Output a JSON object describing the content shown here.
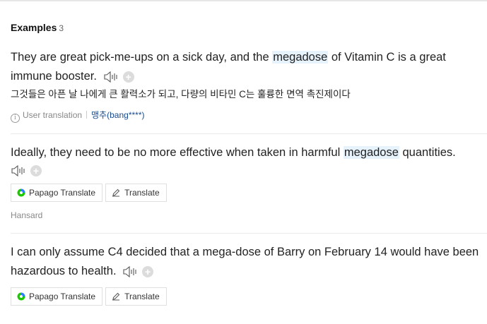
{
  "header": {
    "title": "Examples",
    "count": "3"
  },
  "examples": [
    {
      "before": "They are great pick-me-ups on a sick day, and the ",
      "highlight": "megadose",
      "after": " of Vitamin C is a great immune booster.",
      "translation": "그것들은 아픈 날 나에게 큰 활력소가 되고, 다량의 비타민 C는 훌륭한 면역 촉진제이다",
      "source_label": "User translation",
      "user": "맹추(bang****)"
    },
    {
      "before": "Ideally, they need to be no more effective when taken in harmful ",
      "highlight": "megadose",
      "after": " quantities.",
      "papago_label": "Papago Translate",
      "translate_label": "Translate",
      "source": "Hansard"
    },
    {
      "text": "I can only assume C4 decided that a mega-dose of Barry on February 14 would have been hazardous to health.",
      "papago_label": "Papago Translate",
      "translate_label": "Translate"
    }
  ],
  "icons": {
    "speaker": "speaker-icon",
    "plus": "plus-icon",
    "info": "info-icon",
    "papago": "papago-icon",
    "pencil": "pencil-icon"
  },
  "colors": {
    "highlight_bg": "#e6f2fc",
    "user_link": "#1a4b8c",
    "papago_green": "#1ec800",
    "papago_blue": "#2d7ff9"
  }
}
